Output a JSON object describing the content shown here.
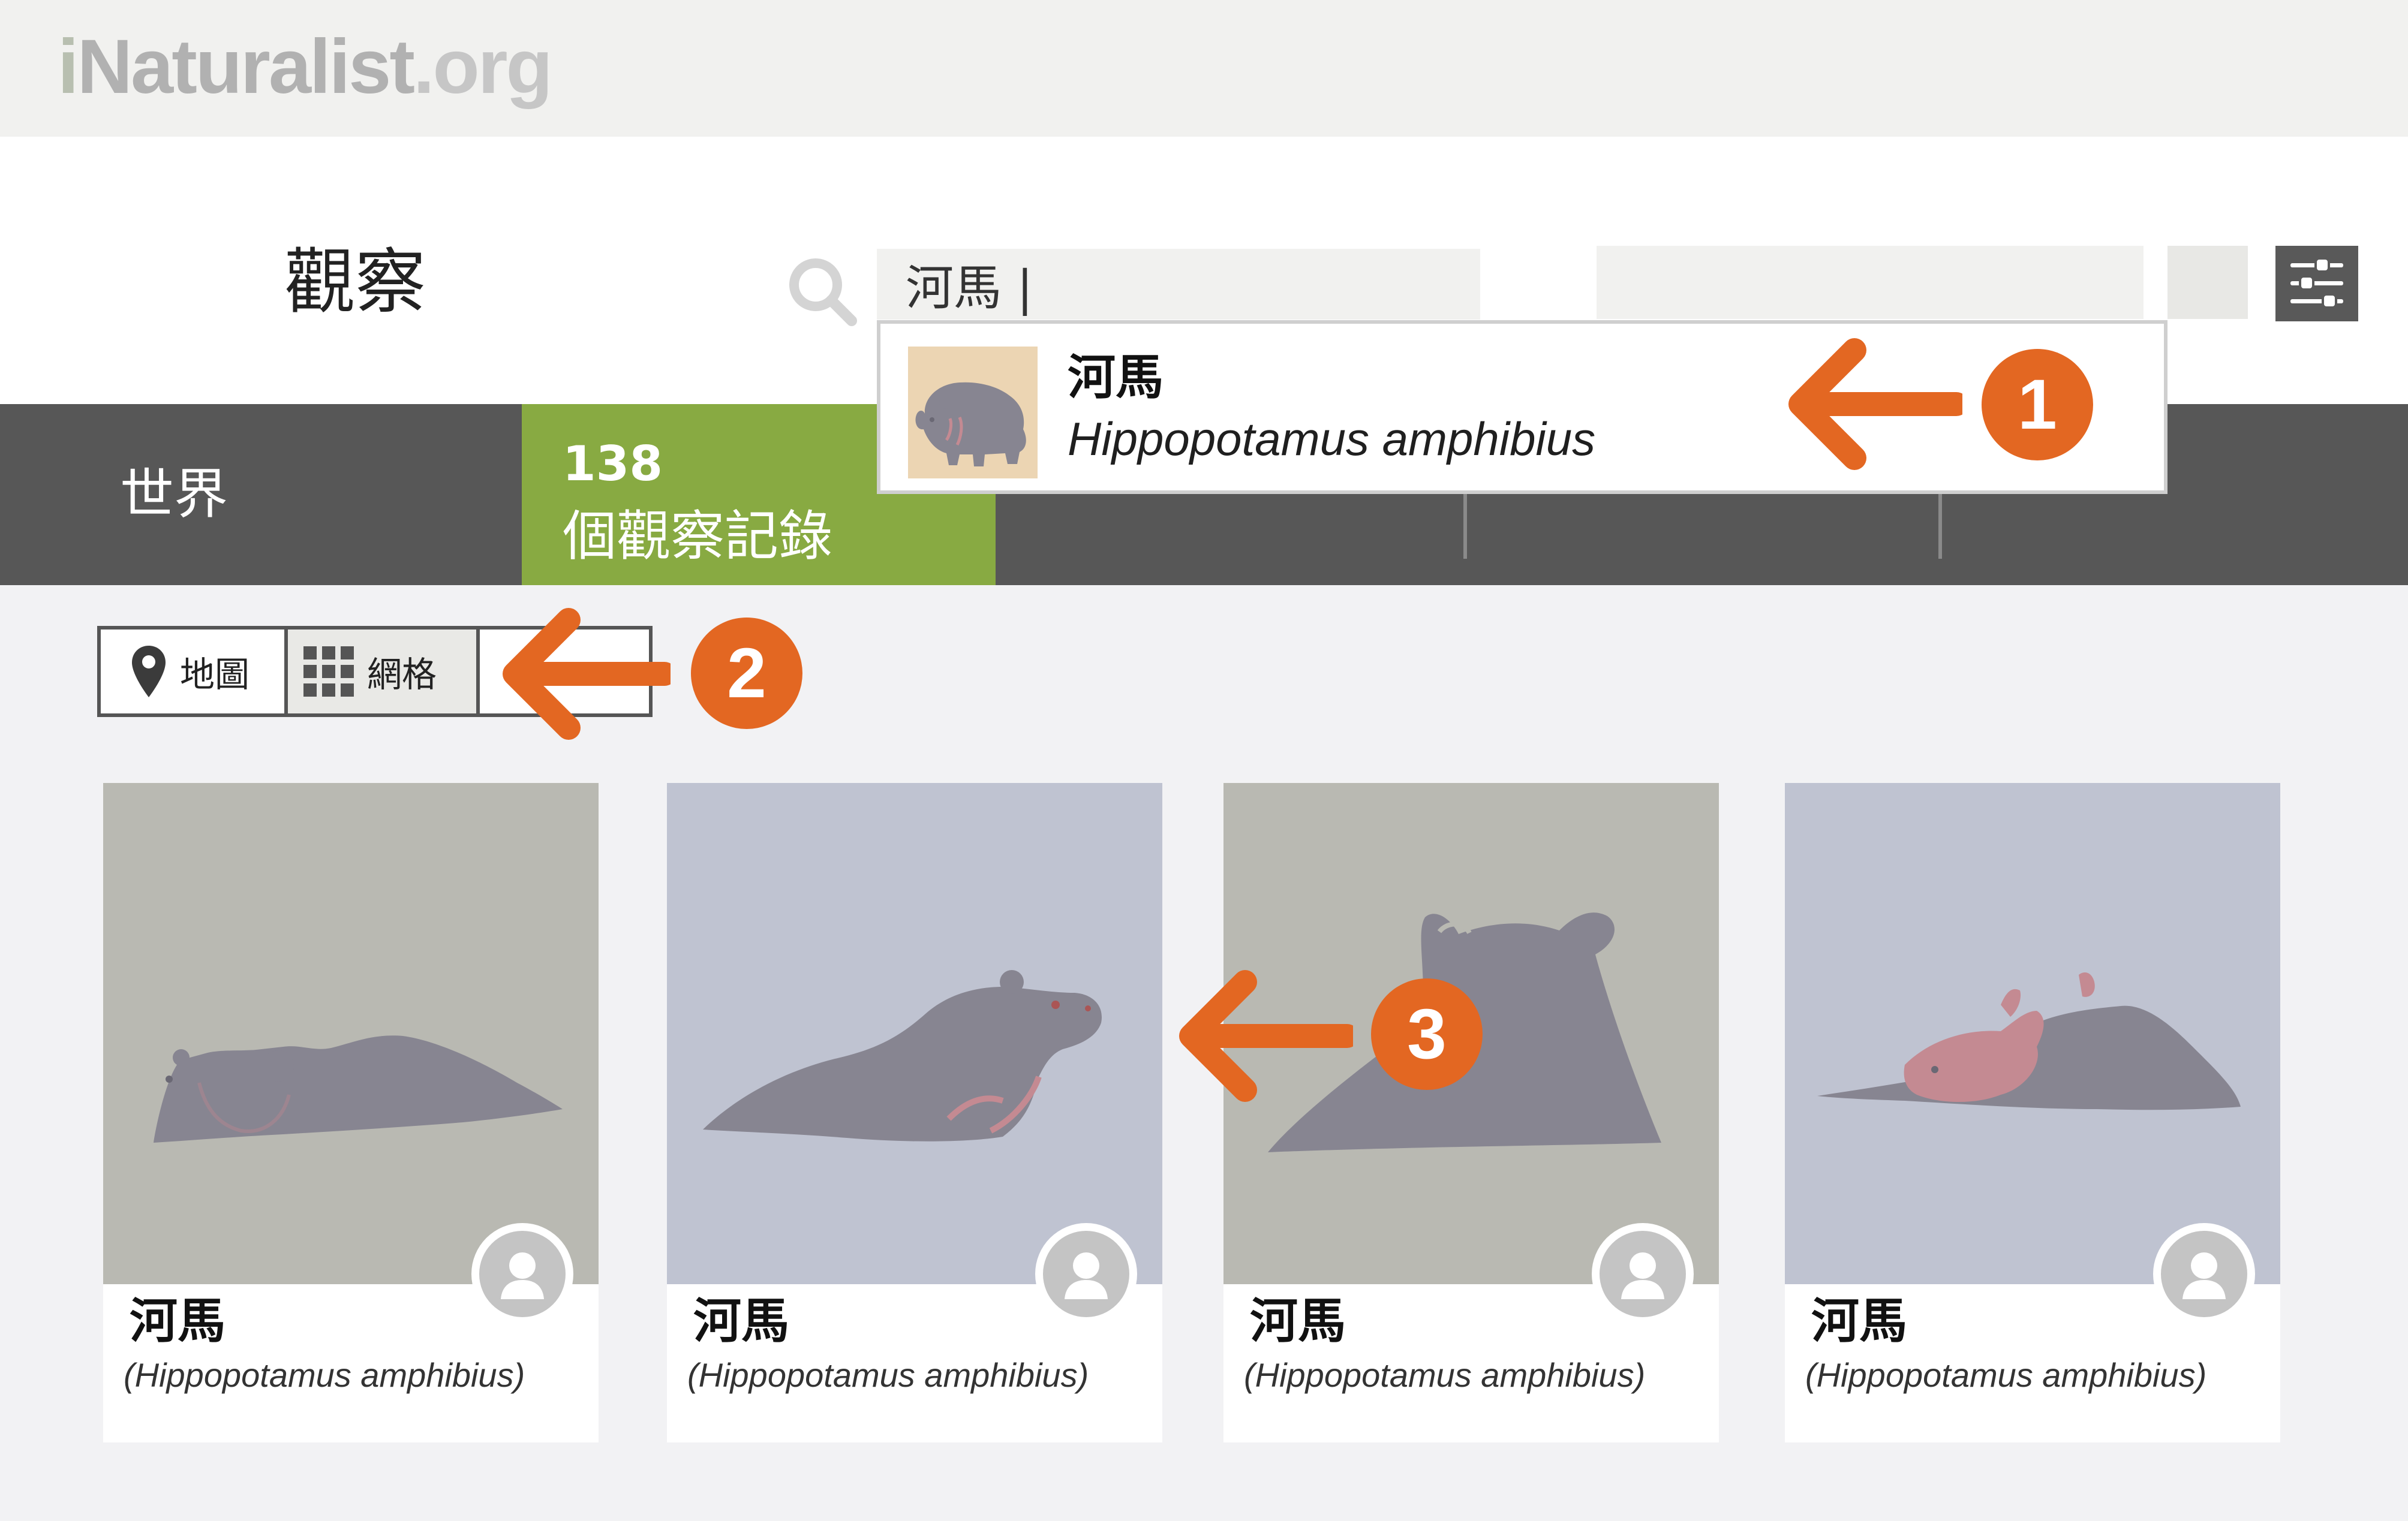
{
  "header": {
    "logo": {
      "prefix": "i",
      "name": "Naturalist",
      "suffix": ".org"
    }
  },
  "page": {
    "title": "觀察"
  },
  "search": {
    "value": "河馬 |"
  },
  "autocomplete": {
    "common_name": "河馬",
    "scientific_name": "Hippopotamus amphibius",
    "thumbnail_icon": "hippo-thumbnail"
  },
  "band": {
    "region": "世界",
    "observations": {
      "count": "138",
      "label": "個觀察記錄"
    }
  },
  "view_toggle": {
    "map_label": "地圖",
    "grid_label": "網格",
    "selected": "grid"
  },
  "cards": [
    {
      "common_name": "河馬",
      "scientific_name": "(Hippopotamus amphibius)",
      "bg": "#b9b9b2"
    },
    {
      "common_name": "河馬",
      "scientific_name": "(Hippopotamus amphibius)",
      "bg": "#bfc3d1"
    },
    {
      "common_name": "河馬",
      "scientific_name": "(Hippopotamus amphibius)",
      "bg": "#b9b9b2"
    },
    {
      "common_name": "河馬",
      "scientific_name": "(Hippopotamus amphibius)",
      "bg": "#bfc3d1"
    }
  ],
  "annotations": [
    {
      "number": "1",
      "target": "autocomplete-result"
    },
    {
      "number": "2",
      "target": "view-toggle"
    },
    {
      "number": "3",
      "target": "observation-photo"
    }
  ],
  "colors": {
    "accent_orange": "#e36722",
    "observations_green": "#88aa42",
    "band_dark": "#575757",
    "hippo_body": "#878591",
    "hippo_pink": "#c48a92"
  }
}
